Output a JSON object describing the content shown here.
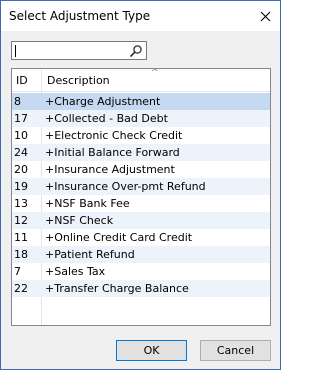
{
  "window": {
    "title": "Select Adjustment Type"
  },
  "search": {
    "value": "",
    "placeholder": ""
  },
  "list": {
    "columns": [
      "ID",
      "Description"
    ],
    "rows": [
      {
        "id": "8",
        "desc": "+Charge Adjustment"
      },
      {
        "id": "17",
        "desc": "+Collected - Bad Debt"
      },
      {
        "id": "10",
        "desc": "+Electronic Check Credit"
      },
      {
        "id": "24",
        "desc": "+Initial Balance Forward"
      },
      {
        "id": "20",
        "desc": "+Insurance Adjustment"
      },
      {
        "id": "19",
        "desc": "+Insurance Over-pmt Refund"
      },
      {
        "id": "13",
        "desc": "+NSF Bank Fee"
      },
      {
        "id": "12",
        "desc": "+NSF Check"
      },
      {
        "id": "11",
        "desc": "+Online Credit Card Credit"
      },
      {
        "id": "18",
        "desc": "+Patient Refund"
      },
      {
        "id": "7",
        "desc": "+Sales Tax"
      },
      {
        "id": "22",
        "desc": "+Transfer Charge Balance"
      }
    ],
    "selected_index": 0
  },
  "buttons": {
    "ok": "OK",
    "cancel": "Cancel"
  },
  "icons": {
    "close": "close-icon",
    "search": "search-icon",
    "sort": "sort-ascending-icon"
  },
  "colors": {
    "selected_row": "#c5d9f1",
    "alt_row": "#edf3fa",
    "window_border": "#3c6bb0"
  }
}
